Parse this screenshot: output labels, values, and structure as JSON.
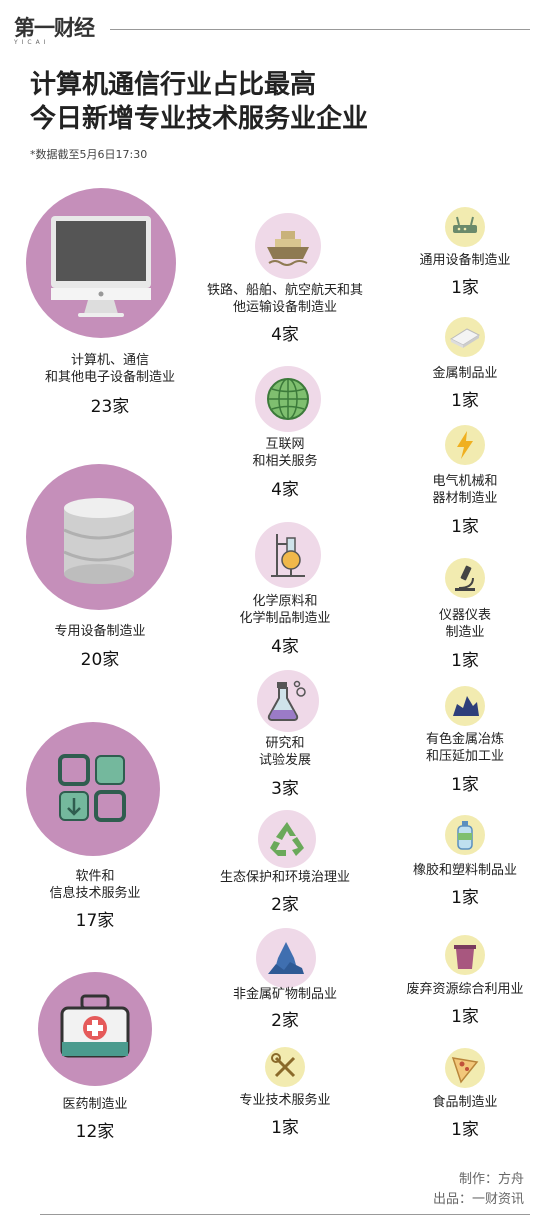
{
  "logo": {
    "main": "第一财经",
    "sub": "YICAI"
  },
  "title": {
    "line1": "计算机通信行业占比最高",
    "line2": "今日新增专业技术服务业企业"
  },
  "note": "*数据截至5月6日17:30",
  "left": [
    {
      "label_lines": [
        "计算机、通信",
        "和其他电子设备制造业"
      ],
      "count": "23家",
      "icon": "imac-computer-icon"
    },
    {
      "label_lines": [
        "专用设备制造业"
      ],
      "count": "20家",
      "icon": "database-cylinder-icon"
    },
    {
      "label_lines": [
        "软件和",
        "信息技术服务业"
      ],
      "count": "17家",
      "icon": "app-grid-download-icon"
    },
    {
      "label_lines": [
        "医药制造业"
      ],
      "count": "12家",
      "icon": "medical-kit-icon"
    }
  ],
  "middle": [
    {
      "label_lines": [
        "铁路、船舶、航空航天和其",
        "他运输设备制造业"
      ],
      "count": "4家",
      "icon": "ship-icon"
    },
    {
      "label_lines": [
        "互联网",
        "和相关服务"
      ],
      "count": "4家",
      "icon": "globe-icon"
    },
    {
      "label_lines": [
        "化学原料和",
        "化学制品制造业"
      ],
      "count": "4家",
      "icon": "chemistry-flask-icon"
    },
    {
      "label_lines": [
        "研究和",
        "试验发展"
      ],
      "count": "3家",
      "icon": "lab-flask-icon"
    },
    {
      "label_lines": [
        "生态保护和环境治理业"
      ],
      "count": "2家",
      "icon": "recycle-icon"
    },
    {
      "label_lines": [
        "非金属矿物制品业"
      ],
      "count": "2家",
      "icon": "mineral-rock-icon"
    },
    {
      "label_lines": [
        "专业技术服务业"
      ],
      "count": "1家",
      "icon": "tools-icon"
    }
  ],
  "right": [
    {
      "label_lines": [
        "通用设备制造业"
      ],
      "count": "1家",
      "icon": "router-device-icon"
    },
    {
      "label_lines": [
        "金属制品业"
      ],
      "count": "1家",
      "icon": "metal-sheet-icon"
    },
    {
      "label_lines": [
        "电气机械和",
        "器材制造业"
      ],
      "count": "1家",
      "icon": "lightning-icon"
    },
    {
      "label_lines": [
        "仪器仪表",
        "制造业"
      ],
      "count": "1家",
      "icon": "microscope-icon"
    },
    {
      "label_lines": [
        "有色金属冶炼",
        "和压延加工业"
      ],
      "count": "1家",
      "icon": "ore-cluster-icon"
    },
    {
      "label_lines": [
        "橡胶和塑料制品业"
      ],
      "count": "1家",
      "icon": "plastic-bottle-icon"
    },
    {
      "label_lines": [
        "废弃资源综合利用业"
      ],
      "count": "1家",
      "icon": "waste-bin-icon"
    },
    {
      "label_lines": [
        "食品制造业"
      ],
      "count": "1家",
      "icon": "pizza-slice-icon"
    }
  ],
  "credits": {
    "maker": "制作：方舟",
    "source": "出品：一财资讯"
  },
  "colors": {
    "big_circle": "#c58fba",
    "mid_circle": "#efd9e8",
    "small_circle": "#f2ebb0"
  }
}
